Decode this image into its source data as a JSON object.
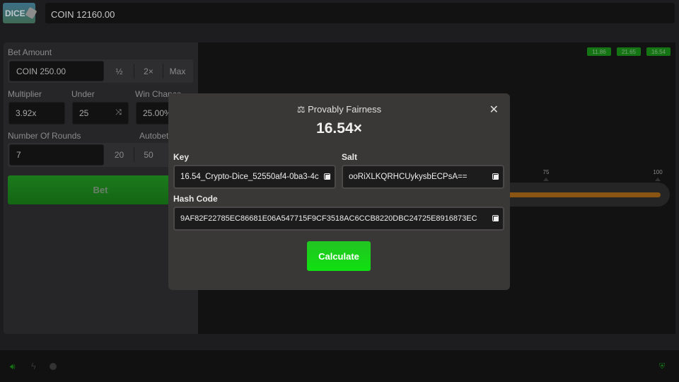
{
  "header": {
    "logo": "DICE",
    "balance": "COIN 12160.00"
  },
  "controls": {
    "bet_amount_label": "Bet Amount",
    "bet_amount_value": "COIN 250.00",
    "half": "½",
    "double": "2×",
    "max": "Max",
    "multiplier_label": "Multiplier",
    "multiplier_value": "3.92x",
    "under_label": "Under",
    "under_value": "25",
    "win_chance_label": "Win Chance",
    "win_chance_value": "25.00%",
    "rounds_label": "Number Of Rounds",
    "rounds_value": "7",
    "autobet_label": "Autobet",
    "round_opt1": "20",
    "round_opt2": "50",
    "bet_button": "Bet"
  },
  "game": {
    "recent_results": [
      "11.86",
      "21.65",
      "16.54"
    ],
    "ticks": [
      "75",
      "100"
    ],
    "slider_value": 100
  },
  "modal": {
    "title": "Provably Fairness",
    "multiplier": "16.54×",
    "key_label": "Key",
    "key_value": "16.54_Crypto-Dice_52550af4-0ba3-4c",
    "salt_label": "Salt",
    "salt_value": "ooRiXLKQRHCUykysbECPsA==",
    "hash_label": "Hash Code",
    "hash_value": "9AF82F22785EC86681E06A547715F9CF3518AC6CCB8220DBC24725E8916873EC",
    "calculate": "Calculate"
  },
  "colors": {
    "accent": "#10e010",
    "bar": "#8a5512"
  }
}
